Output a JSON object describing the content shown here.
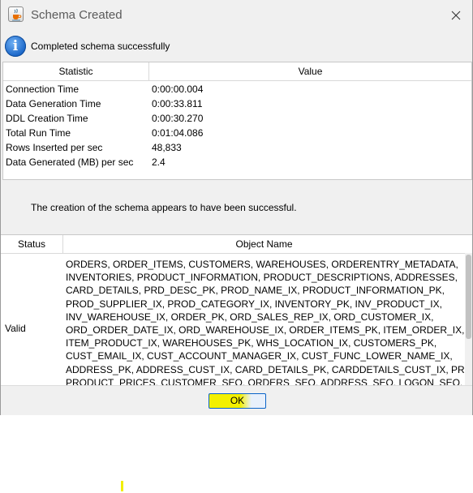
{
  "window": {
    "title": "Schema Created",
    "close_glyph": "✕",
    "icon": "java-cup-icon"
  },
  "info": {
    "icon": "info-icon",
    "icon_glyph": "i",
    "message": "Completed schema successfully"
  },
  "stats": {
    "headers": [
      "Statistic",
      "Value"
    ],
    "rows": [
      {
        "statistic": "Connection Time",
        "value": "0:00:00.004"
      },
      {
        "statistic": "Data Generation Time",
        "value": "0:00:33.811"
      },
      {
        "statistic": "DDL Creation Time",
        "value": "0:00:30.270"
      },
      {
        "statistic": "Total Run Time",
        "value": "0:01:04.086"
      },
      {
        "statistic": "Rows Inserted per sec",
        "value": "48,833"
      },
      {
        "statistic": "Data Generated (MB) per sec",
        "value": "2.4"
      }
    ]
  },
  "result_message": "The creation of the schema appears to have been successful.",
  "objects": {
    "headers": [
      "Status",
      "Object Name"
    ],
    "status": "Valid",
    "name_lines": [
      "ORDERS, ORDER_ITEMS, CUSTOMERS, WAREHOUSES, ORDERENTRY_METADATA,",
      "INVENTORIES, PRODUCT_INFORMATION, PRODUCT_DESCRIPTIONS, ADDRESSES,",
      "CARD_DETAILS, PRD_DESC_PK, PROD_NAME_IX, PRODUCT_INFORMATION_PK,",
      "PROD_SUPPLIER_IX, PROD_CATEGORY_IX, INVENTORY_PK, INV_PRODUCT_IX,",
      "INV_WAREHOUSE_IX, ORDER_PK, ORD_SALES_REP_IX, ORD_CUSTOMER_IX,",
      "ORD_ORDER_DATE_IX, ORD_WAREHOUSE_IX, ORDER_ITEMS_PK, ITEM_ORDER_IX,",
      "ITEM_PRODUCT_IX, WAREHOUSES_PK, WHS_LOCATION_IX, CUSTOMERS_PK,",
      "CUST_EMAIL_IX, CUST_ACCOUNT_MANAGER_IX, CUST_FUNC_LOWER_NAME_IX,",
      "ADDRESS_PK, ADDRESS_CUST_IX, CARD_DETAILS_PK, CARDDETAILS_CUST_IX, PRODUCTS,",
      "PRODUCT_PRICES, CUSTOMER_SEQ, ORDERS_SEQ, ADDRESS_SEQ, LOGON_SEQ,"
    ]
  },
  "buttons": {
    "ok_label": "OK"
  },
  "colors": {
    "highlight": "#f3f000",
    "info_blue": "#1a66c8",
    "button_border": "#0a64c8"
  }
}
